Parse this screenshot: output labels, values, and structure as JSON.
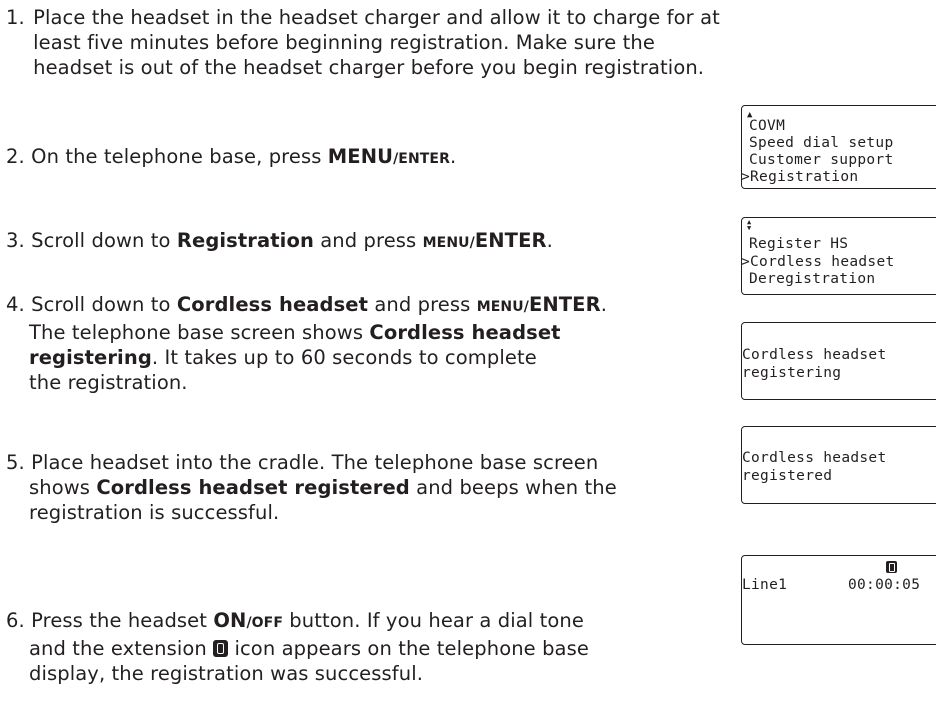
{
  "steps": [
    {
      "num": "1.",
      "text": "Place the headset in the headset charger and allow it to charge for at least five minutes before beginning registration. Make sure the headset is out of the headset charger before you begin registration."
    },
    {
      "num": "2.",
      "pre": "On the telephone base, press ",
      "key_main": "MENU",
      "key_sep": "/ENTER",
      "post": "."
    },
    {
      "num": "3.",
      "pre": "Scroll down to ",
      "item": "Registration",
      "mid": " and press ",
      "key_small": "MENU/",
      "key_main": "ENTER",
      "post": "."
    },
    {
      "num": "4.",
      "pre": "Scroll down to ",
      "item": "Cordless headset",
      "mid": " and press ",
      "key_small": "MENU/",
      "key_main": "ENTER",
      "post": ".",
      "line2_pre": "The telephone base screen shows ",
      "line2_bold": "Cordless headset",
      "line3_bold": "registering",
      "line3_post": ". It takes up to 60 seconds to complete",
      "line4": "the registration."
    },
    {
      "num": "5.",
      "line1": "Place headset into the cradle. The telephone base screen",
      "line2_pre": "shows ",
      "line2_bold": "Cordless headset registered",
      "line2_post": " and beeps when the",
      "line3": "registration is successful."
    },
    {
      "num": "6.",
      "pre": "Press the headset ",
      "key_main": "ON",
      "key_small": "/OFF",
      "post": " button. If you hear a dial tone",
      "line2_pre": "and the extension ",
      "line2_post": " icon appears on the telephone base",
      "line3": "display, the registration was successful."
    }
  ],
  "screens": {
    "menu": {
      "arrow": "▲",
      "lines": [
        "COVM",
        "Speed dial setup",
        "Customer support",
        ">Registration"
      ]
    },
    "registration": {
      "arrow": "▲▼",
      "lines": [
        "Register HS",
        ">Cordless headset",
        "Deregistration"
      ]
    },
    "registering": {
      "lines": [
        "Cordless headset",
        "registering"
      ]
    },
    "registered": {
      "lines": [
        "Cordless headset",
        "registered"
      ]
    },
    "idle": {
      "lines": [
        "Line1",
        "00:00:05"
      ]
    }
  }
}
